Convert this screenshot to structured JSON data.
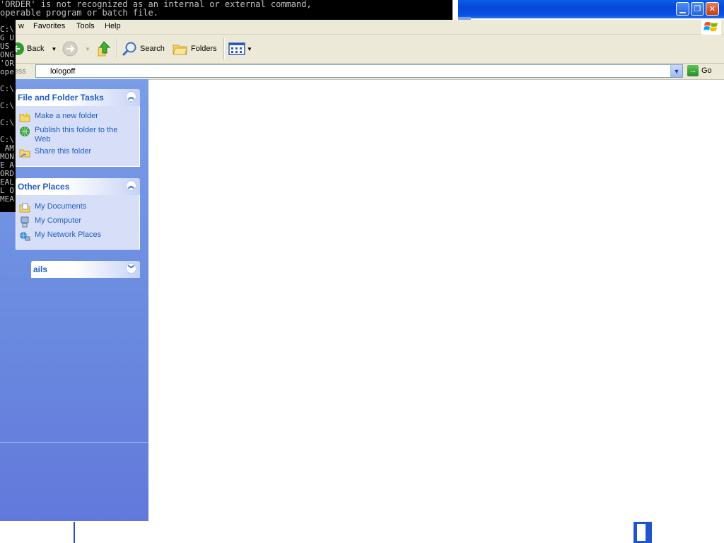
{
  "console": {
    "top_lines": [
      "'ORDER' is not recognized as an internal or external command,",
      "operable program or batch file."
    ],
    "strip_lines": [
      "C:\\",
      "G U",
      "US",
      "ONG",
      "'OR",
      "ope",
      "",
      "C:\\",
      "",
      "C:\\",
      "",
      "C:\\",
      "",
      "C:\\",
      " AM",
      "MON",
      "E A",
      "ORD",
      "EAL",
      "L O",
      "MEA"
    ]
  },
  "menubar": {
    "items": [
      "w",
      "Favorites",
      "Tools",
      "Help"
    ]
  },
  "toolbar": {
    "back_label": "Back",
    "search_label": "Search",
    "folders_label": "Folders"
  },
  "address": {
    "label": "ress",
    "value": "lologoff",
    "go_label": "Go"
  },
  "sidebar": {
    "file_tasks": {
      "title": "File and Folder Tasks",
      "items": [
        "Make a new folder",
        "Publish this folder to the Web",
        "Share this folder"
      ]
    },
    "other_places": {
      "title": "Other Places",
      "items": [
        "My Documents",
        "My Computer",
        "My Network Places"
      ]
    },
    "details": {
      "title": "ails"
    }
  },
  "colors": {
    "titlebar": "#0747d8",
    "sidepane": "#6b8ce0",
    "link": "#215dc6"
  }
}
